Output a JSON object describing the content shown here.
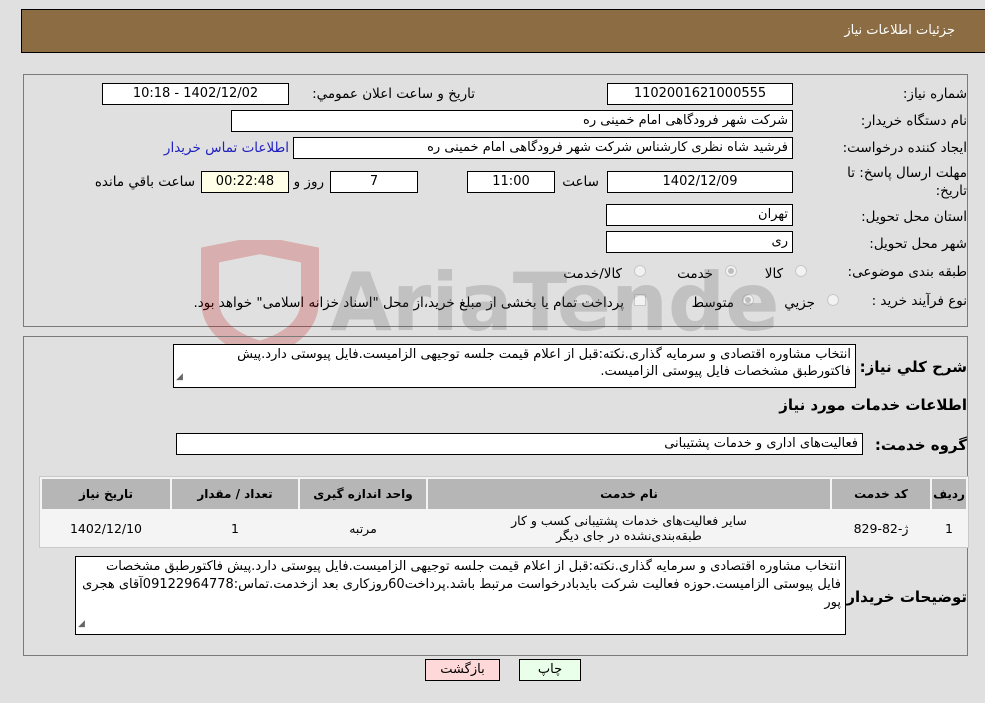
{
  "header": {
    "title": "جزئیات اطلاعات نیاز"
  },
  "form": {
    "need_number": {
      "label": "شماره نیاز:",
      "value": "1102001621000555"
    },
    "announce_datetime": {
      "label": "تاریخ و ساعت اعلان عمومي:",
      "value": "1402/12/02 - 10:18"
    },
    "buyer_org": {
      "label": "نام دستگاه خریدار:",
      "value": "شرکت شهر فرودگاهی امام خمینی  ره"
    },
    "requester": {
      "label": "ایجاد کننده درخواست:",
      "value": "فرشید شاه نظری کارشناس شرکت شهر فرودگاهی امام خمینی  ره"
    },
    "buyer_contact_link": "اطلاعات تماس خریدار",
    "deadline": {
      "label": "مهلت ارسال پاسخ: تا تاریخ:",
      "date": "1402/12/09",
      "time_label": "ساعت",
      "time": "11:00",
      "days": "7",
      "days_label": "روز و",
      "remaining": "00:22:48",
      "remaining_label": "ساعت باقي مانده"
    },
    "province": {
      "label": "استان محل تحویل:",
      "value": "تهران"
    },
    "city": {
      "label": "شهر محل تحویل:",
      "value": "ری"
    },
    "category": {
      "label": "طبقه بندی موضوعی:",
      "options": [
        {
          "label": "کالا",
          "checked": false
        },
        {
          "label": "خدمت",
          "checked": true
        },
        {
          "label": "کالا/خدمت",
          "checked": false
        }
      ]
    },
    "process_type": {
      "label": "نوع فرآیند خرید :",
      "options": [
        {
          "label": "جزيي",
          "checked": false
        },
        {
          "label": "متوسط",
          "checked": true
        }
      ],
      "treasury_checkbox_label": "پرداخت تمام یا بخشی از مبلغ خرید،از محل \"اسناد خزانه اسلامی\" خواهد بود."
    }
  },
  "description": {
    "label": "شرح کلي نیاز:",
    "value": "انتخاب مشاوره اقتصادی و سرمایه گذاری.نکته:قبل از اعلام قیمت جلسه توجیهی الزامیست.فایل پیوستی دارد.پیش فاکتورطبق مشخصات فایل پیوستی الزامیست."
  },
  "services": {
    "section_title": "اطلاعات خدمات مورد نیاز",
    "group_label": "گروه خدمت:",
    "group_value": "فعالیت‌های اداری و خدمات پشتیبانی",
    "table": {
      "headers": [
        "ردیف",
        "کد خدمت",
        "نام خدمت",
        "واحد اندازه گیری",
        "تعداد / مقدار",
        "تاریخ نیاز"
      ],
      "rows": [
        [
          "1",
          "ژ-82-829",
          "سایر فعالیت‌های خدمات پشتیبانی کسب و کار طبقه‌بندی‌نشده در جای دیگر",
          "مرتبه",
          "1",
          "1402/12/10"
        ]
      ]
    }
  },
  "buyer_notes": {
    "label": "توضیحات خریدار:",
    "value": "انتخاب مشاوره اقتصادی و سرمایه گذاری.نکته:قبل از اعلام قیمت جلسه توجیهی الزامیست.فایل پیوستی دارد.پیش فاکتورطبق مشخصات فایل پیوستی الزامیست.حوزه فعالیت شرکت بایدبادرخواست مرتبط باشد.پرداخت60روزکاری بعد ازخدمت.تماس:09122964778آقای هجری پور"
  },
  "buttons": {
    "print": "چاپ",
    "back": "بازگشت"
  },
  "colors": {
    "header_bg": "#8c6c42",
    "print_bg": "#eaffea",
    "back_bg": "#ffd9d9",
    "link": "#2020c0"
  }
}
